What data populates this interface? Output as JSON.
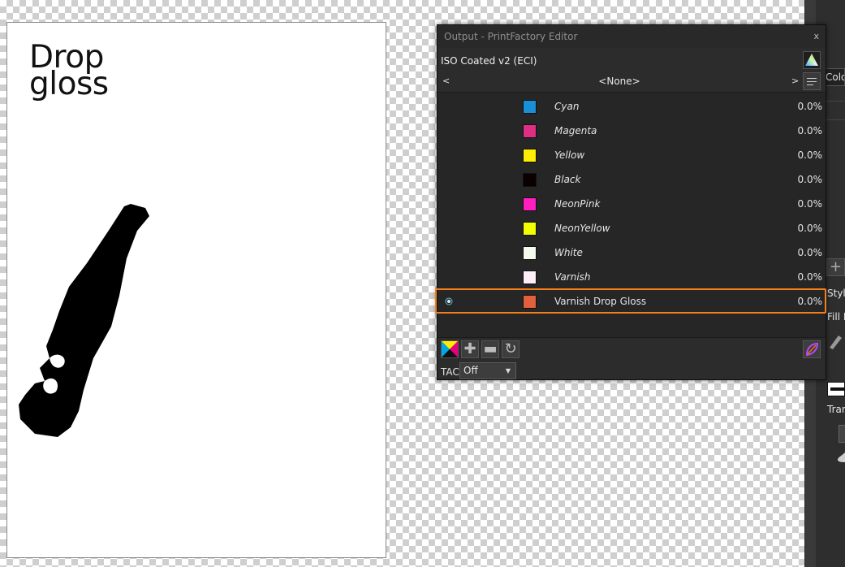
{
  "document": {
    "title_lines": [
      "Drop",
      "gloss"
    ]
  },
  "editor": {
    "title": "Output - PrintFactory Editor",
    "close_label": "x",
    "profile": "ISO Coated v2 (ECI)",
    "nav": {
      "prev": "<",
      "preset": "<None>",
      "next": ">"
    },
    "inks": [
      {
        "name": "Cyan",
        "color": "#1a8fd7",
        "value": "0.0%",
        "visible": false,
        "italic": true
      },
      {
        "name": "Magenta",
        "color": "#de2f83",
        "value": "0.0%",
        "visible": false,
        "italic": true
      },
      {
        "name": "Yellow",
        "color": "#ffee00",
        "value": "0.0%",
        "visible": false,
        "italic": true
      },
      {
        "name": "Black",
        "color": "#0a0000",
        "value": "0.0%",
        "visible": false,
        "italic": true
      },
      {
        "name": "NeonPink",
        "color": "#ff1fbf",
        "value": "0.0%",
        "visible": false,
        "italic": true
      },
      {
        "name": "NeonYellow",
        "color": "#f2ff00",
        "value": "0.0%",
        "visible": false,
        "italic": true
      },
      {
        "name": "White",
        "color": "#f4fbec",
        "value": "0.0%",
        "visible": false,
        "italic": true
      },
      {
        "name": "Varnish",
        "color": "#fdeef8",
        "value": "0.0%",
        "visible": false,
        "italic": true
      },
      {
        "name": "Varnish Drop Gloss",
        "color": "#e2603c",
        "value": "0.0%",
        "visible": true,
        "italic": false
      }
    ],
    "tac_label": "TAC",
    "tac_value": "Off",
    "highlight_color": "#f27f1a"
  },
  "studio": {
    "colour_tab": "Colo",
    "style_label": "Style",
    "fill_label": "Fill I",
    "transform_label": "Tran",
    "plus_glyph": "+"
  }
}
